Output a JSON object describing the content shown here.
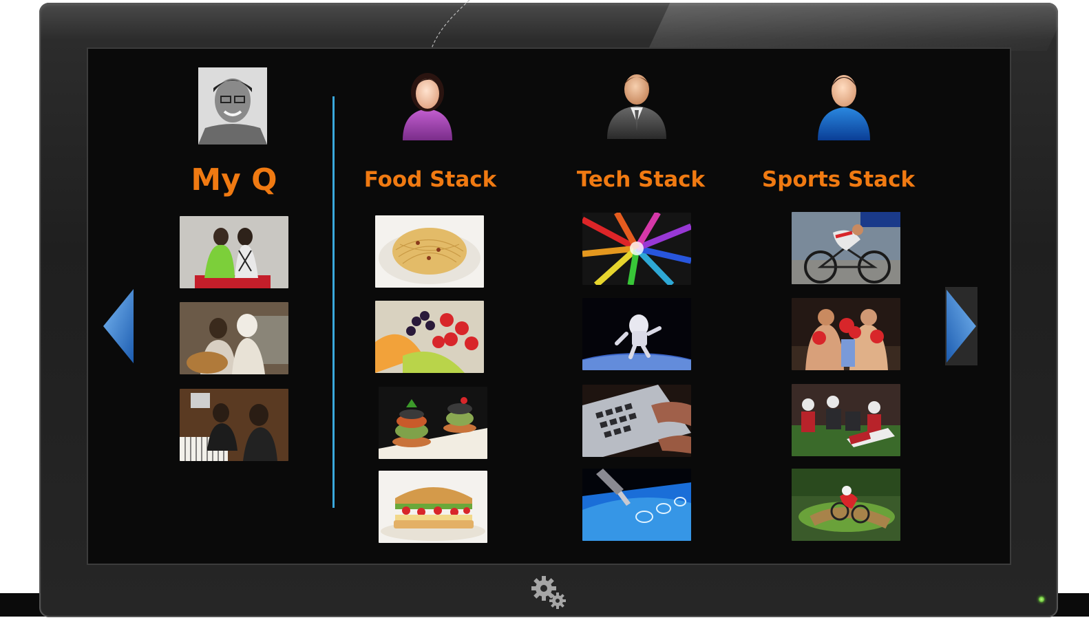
{
  "myq": {
    "title": "My Q",
    "photos": [
      "friends-on-couch",
      "duet-with-guitar",
      "piano-duo"
    ]
  },
  "stacks": [
    {
      "title": "Food Stack",
      "avatar": "woman-purple-avatar-icon",
      "photos": [
        "spaghetti-plate",
        "fruit-bowl",
        "veggie-towers",
        "sandwich"
      ]
    },
    {
      "title": "Tech Stack",
      "avatar": "businessman-avatar-icon",
      "photos": [
        "light-burst",
        "astronaut",
        "laptop-keyboard",
        "touch-screen"
      ]
    },
    {
      "title": "Sports Stack",
      "avatar": "man-blue-avatar-icon",
      "photos": [
        "cyclist",
        "boxing-match",
        "football-tackle",
        "bmx-rider"
      ]
    }
  ],
  "controls": {
    "prev": "left-arrow-icon",
    "next": "right-arrow-icon",
    "settings": "gear-icon"
  },
  "colors": {
    "heading": "#f07a12",
    "divider": "#3aa8dc",
    "arrow": "#3b7fd1"
  }
}
